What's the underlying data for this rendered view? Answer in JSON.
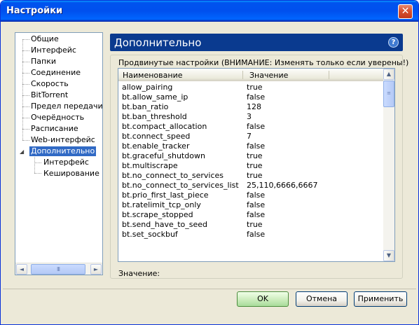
{
  "window": {
    "title": "Настройки",
    "close_glyph": "✕"
  },
  "tree": {
    "items": [
      {
        "label": "Общие"
      },
      {
        "label": "Интерфейс"
      },
      {
        "label": "Папки"
      },
      {
        "label": "Соединение"
      },
      {
        "label": "Скорость"
      },
      {
        "label": "BitTorrent"
      },
      {
        "label": "Предел передачи"
      },
      {
        "label": "Очерёдность"
      },
      {
        "label": "Расписание"
      },
      {
        "label": "Web-интерфейс"
      },
      {
        "label": "Дополнительно"
      }
    ],
    "children": [
      {
        "label": "Интерфейс"
      },
      {
        "label": "Кеширование"
      }
    ],
    "selected": "Дополнительно"
  },
  "section": {
    "title": "Дополнительно",
    "help_glyph": "?"
  },
  "group": {
    "label": "Продвинутые настройки (ВНИМАНИЕ: Изменять только если уверены!)"
  },
  "table": {
    "headers": {
      "name": "Наименование",
      "value": "Значение"
    },
    "rows": [
      {
        "name": "allow_pairing",
        "value": "true"
      },
      {
        "name": "bt.allow_same_ip",
        "value": "false"
      },
      {
        "name": "bt.ban_ratio",
        "value": "128"
      },
      {
        "name": "bt.ban_threshold",
        "value": "3"
      },
      {
        "name": "bt.compact_allocation",
        "value": "false"
      },
      {
        "name": "bt.connect_speed",
        "value": "7"
      },
      {
        "name": "bt.enable_tracker",
        "value": "false"
      },
      {
        "name": "bt.graceful_shutdown",
        "value": "true"
      },
      {
        "name": "bt.multiscrape",
        "value": "true"
      },
      {
        "name": "bt.no_connect_to_services",
        "value": "true"
      },
      {
        "name": "bt.no_connect_to_services_list",
        "value": "25,110,6666,6667"
      },
      {
        "name": "bt.prio_first_last_piece",
        "value": "false"
      },
      {
        "name": "bt.ratelimit_tcp_only",
        "value": "false"
      },
      {
        "name": "bt.scrape_stopped",
        "value": "false"
      },
      {
        "name": "bt.send_have_to_seed",
        "value": "true"
      },
      {
        "name": "bt.set_sockbuf",
        "value": "false"
      }
    ]
  },
  "value_field": {
    "label": "Значение:"
  },
  "buttons": {
    "ok": "OK",
    "cancel": "Отмена",
    "apply": "Применить"
  },
  "scroll_glyphs": {
    "up": "▲",
    "down": "▼",
    "left": "◄",
    "right": "►",
    "grip_h": "III",
    "grip_v": "≡"
  }
}
